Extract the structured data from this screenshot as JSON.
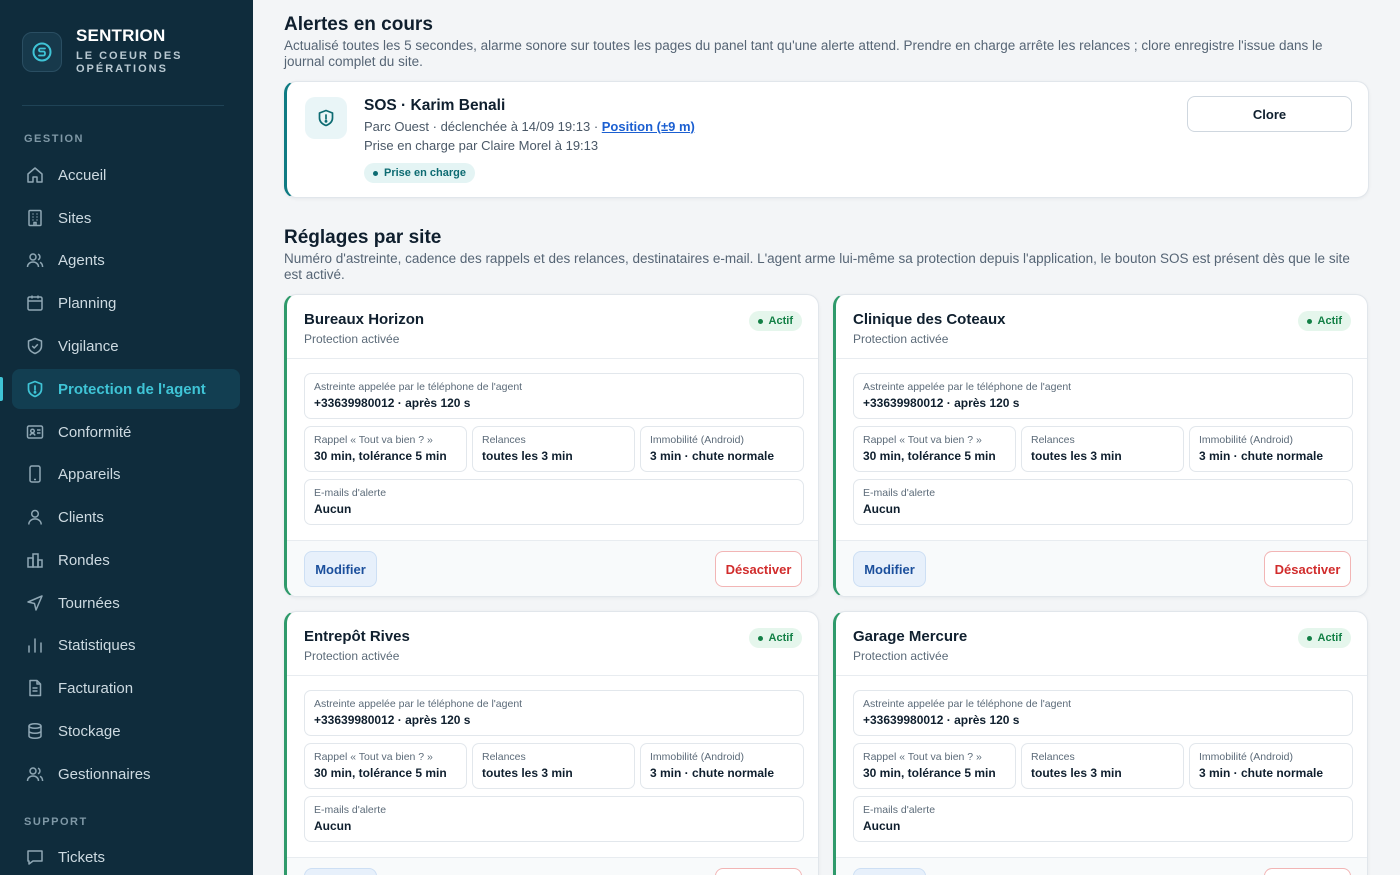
{
  "brand": {
    "name": "SENTRION",
    "tagline": "LE COEUR DES OPÉRATIONS",
    "logo_icon": "sentrion-logo-icon"
  },
  "sidebar": {
    "section_gestion": "GESTION",
    "section_support": "SUPPORT",
    "items": [
      {
        "label": "Accueil",
        "icon": "home-icon"
      },
      {
        "label": "Sites",
        "icon": "building-icon"
      },
      {
        "label": "Agents",
        "icon": "users-icon"
      },
      {
        "label": "Planning",
        "icon": "calendar-icon"
      },
      {
        "label": "Vigilance",
        "icon": "shield-check-icon"
      },
      {
        "label": "Protection de l'agent",
        "icon": "shield-icon",
        "active": true
      },
      {
        "label": "Conformité",
        "icon": "id-card-icon"
      },
      {
        "label": "Appareils",
        "icon": "phone-icon"
      },
      {
        "label": "Clients",
        "icon": "user-icon"
      },
      {
        "label": "Rondes",
        "icon": "buildings-icon"
      },
      {
        "label": "Tournées",
        "icon": "navigation-icon"
      },
      {
        "label": "Statistiques",
        "icon": "bar-chart-icon"
      },
      {
        "label": "Facturation",
        "icon": "file-icon"
      },
      {
        "label": "Stockage",
        "icon": "database-icon"
      },
      {
        "label": "Gestionnaires",
        "icon": "users-cog-icon"
      }
    ],
    "support_items": [
      {
        "label": "Tickets",
        "icon": "message-icon"
      }
    ]
  },
  "alerts": {
    "title": "Alertes en cours",
    "description": "Actualisé toutes les 5 secondes, alarme sonore sur toutes les pages du panel tant qu'une alerte attend. Prendre en charge arrête les relances ; clore enregistre l'issue dans le journal complet du site.",
    "item": {
      "title": "SOS · Karim Benali",
      "meta": "Parc Ouest · déclenchée à 14/09 19:13 · ",
      "position_link": "Position (±9 m)",
      "taken_by": "Prise en charge par Claire Morel à 19:13",
      "status": "Prise en charge",
      "close_label": "Clore"
    }
  },
  "settings": {
    "title": "Réglages par site",
    "description": "Numéro d'astreinte, cadence des rappels et des relances, destinataires e-mail. L'agent arme lui-même sa protection depuis l'application, le bouton SOS est présent dès que le site est activé.",
    "labels": {
      "astreinte": "Astreinte appelée par le téléphone de l'agent",
      "rappel": "Rappel « Tout va bien ? »",
      "relances": "Relances",
      "immobilite": "Immobilité (Android)",
      "emails": "E-mails d'alerte",
      "modifier": "Modifier",
      "desactiver": "Désactiver"
    },
    "sites": [
      {
        "name": "Bureaux Horizon",
        "subtitle": "Protection activée",
        "status": "Actif",
        "astreinte": "+33639980012 · après 120 s",
        "rappel": "30 min, tolérance 5 min",
        "relances": "toutes les 3 min",
        "immobilite": "3 min · chute normale",
        "emails": "Aucun"
      },
      {
        "name": "Clinique des Coteaux",
        "subtitle": "Protection activée",
        "status": "Actif",
        "astreinte": "+33639980012 · après 120 s",
        "rappel": "30 min, tolérance 5 min",
        "relances": "toutes les 3 min",
        "immobilite": "3 min · chute normale",
        "emails": "Aucun"
      },
      {
        "name": "Entrepôt Rives",
        "subtitle": "Protection activée",
        "status": "Actif",
        "astreinte": "+33639980012 · après 120 s",
        "rappel": "30 min, tolérance 5 min",
        "relances": "toutes les 3 min",
        "immobilite": "3 min · chute normale",
        "emails": "Aucun"
      },
      {
        "name": "Garage Mercure",
        "subtitle": "Protection activée",
        "status": "Actif",
        "astreinte": "+33639980012 · après 120 s",
        "rappel": "30 min, tolérance 5 min",
        "relances": "toutes les 3 min",
        "immobilite": "3 min · chute normale",
        "emails": "Aucun"
      }
    ]
  },
  "colors": {
    "sidebar_bg": "#0f2c3c",
    "accent": "#3fc4d6",
    "active_green": "#2f9a6b",
    "danger": "#d12c2c",
    "link": "#1b5fd1"
  }
}
